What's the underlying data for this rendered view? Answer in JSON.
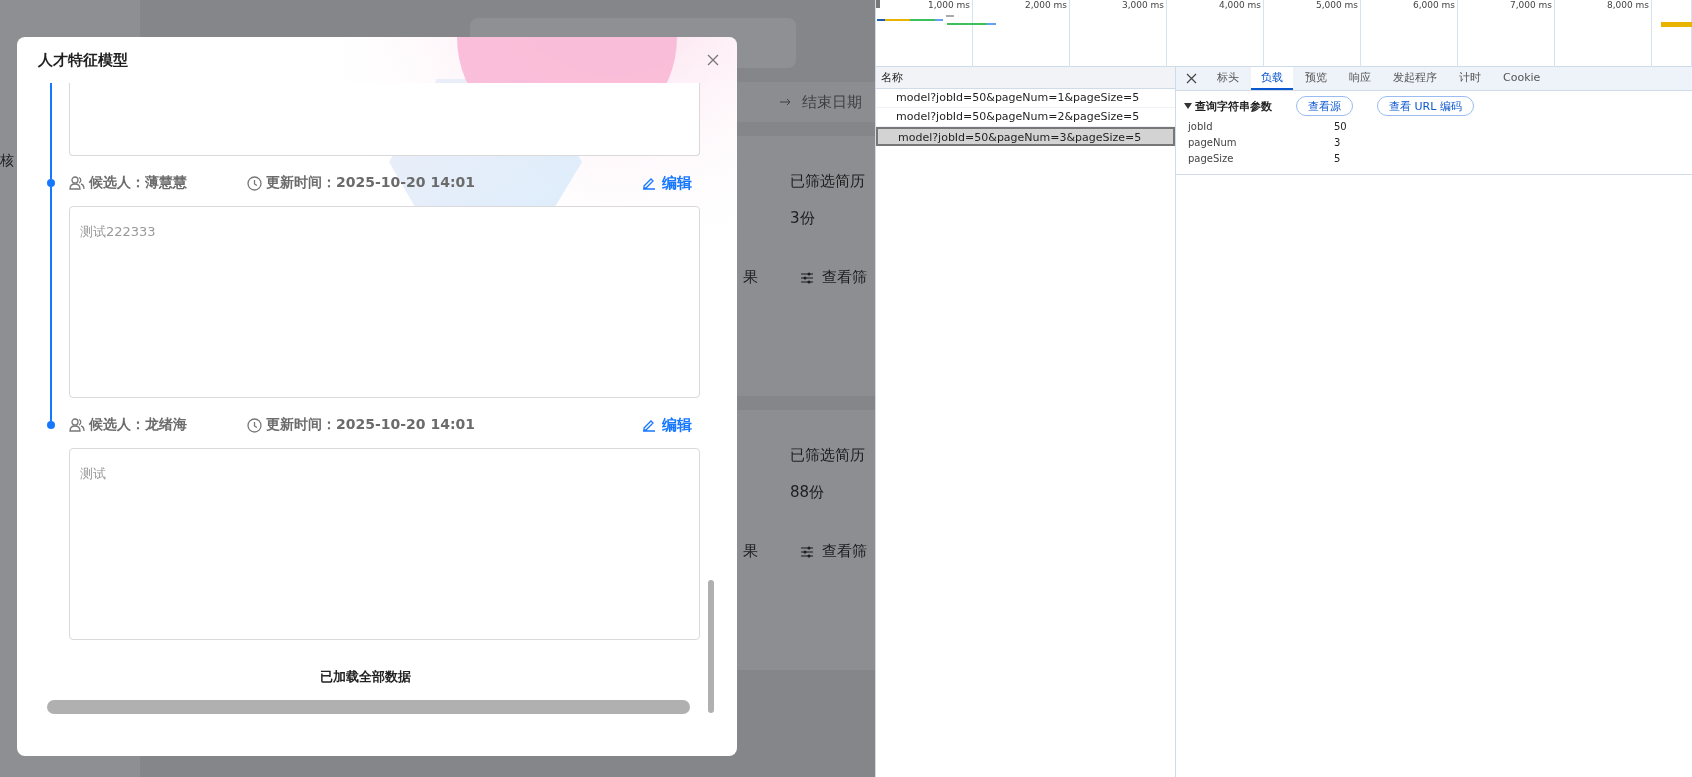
{
  "app": {
    "sidebar_fragment": "核",
    "date_end": "结束日期",
    "cards": [
      {
        "stat_label": "已筛选简历",
        "stat_value": "3份",
        "action_fragment": "果",
        "filter_action": "查看筛"
      },
      {
        "stat_label": "已筛选简历",
        "stat_value": "88份",
        "action_fragment": "果",
        "filter_action": "查看筛"
      }
    ]
  },
  "modal": {
    "title": "人才特征模型",
    "entries": [
      {
        "candidate": "候选人：薄慧慧",
        "updated": "更新时间：2025-10-20 14:01",
        "edit": "编辑",
        "note": "测试222333"
      },
      {
        "candidate": "候选人：龙绪海",
        "updated": "更新时间：2025-10-20 14:01",
        "edit": "编辑",
        "note": "测试"
      }
    ],
    "footer": "已加载全部数据"
  },
  "devtools": {
    "timeline_ticks": [
      "1,000 ms",
      "2,000 ms",
      "3,000 ms",
      "4,000 ms",
      "5,000 ms",
      "6,000 ms",
      "7,000 ms",
      "8,000 ms"
    ],
    "name_header": "名称",
    "requests": [
      {
        "label": "model?jobId=50&pageNum=1&pageSize=5",
        "selected": false
      },
      {
        "label": "model?jobId=50&pageNum=2&pageSize=5",
        "selected": false
      },
      {
        "label": "model?jobId=50&pageNum=3&pageSize=5",
        "selected": true
      }
    ],
    "tabs": [
      {
        "label": "标头",
        "selected": false
      },
      {
        "label": "负载",
        "selected": true
      },
      {
        "label": "预览",
        "selected": false
      },
      {
        "label": "响应",
        "selected": false
      },
      {
        "label": "发起程序",
        "selected": false
      },
      {
        "label": "计时",
        "selected": false
      },
      {
        "label": "Cookie",
        "selected": false
      }
    ],
    "section_title": "查询字符串参数",
    "section_expanded": true,
    "buttons": [
      "查看源",
      "查看 URL 编码"
    ],
    "params": [
      {
        "name": "jobId",
        "value": "50"
      },
      {
        "name": "pageNum",
        "value": "3"
      },
      {
        "name": "pageSize",
        "value": "5"
      }
    ]
  }
}
